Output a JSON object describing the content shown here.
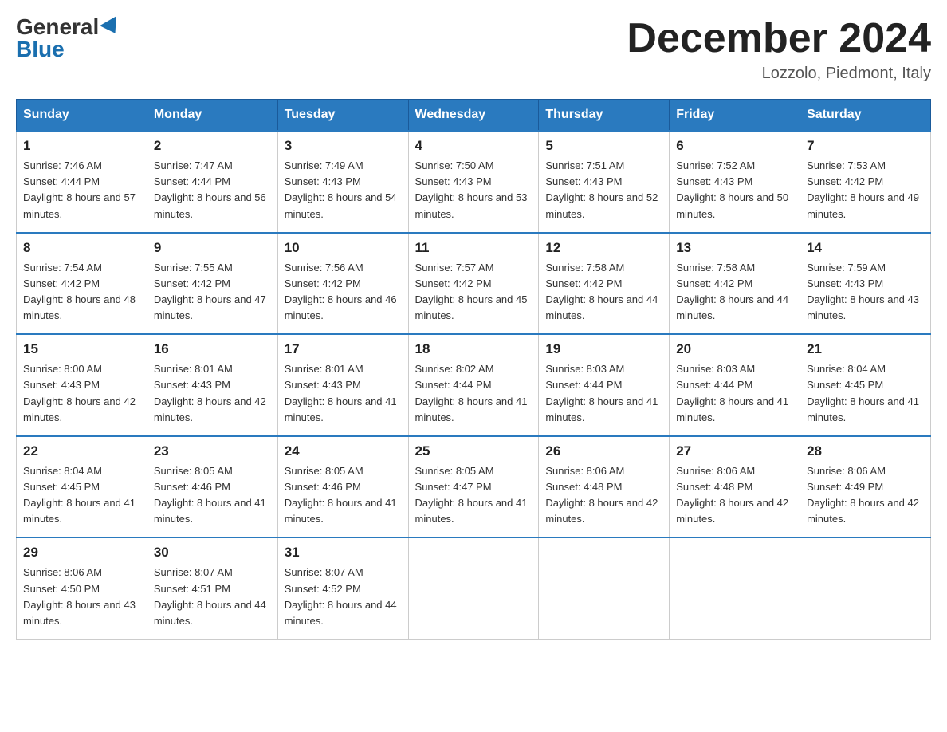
{
  "header": {
    "logo_general": "General",
    "logo_blue": "Blue",
    "month_title": "December 2024",
    "location": "Lozzolo, Piedmont, Italy"
  },
  "days_of_week": [
    "Sunday",
    "Monday",
    "Tuesday",
    "Wednesday",
    "Thursday",
    "Friday",
    "Saturday"
  ],
  "weeks": [
    [
      {
        "day": "1",
        "sunrise": "7:46 AM",
        "sunset": "4:44 PM",
        "daylight": "8 hours and 57 minutes."
      },
      {
        "day": "2",
        "sunrise": "7:47 AM",
        "sunset": "4:44 PM",
        "daylight": "8 hours and 56 minutes."
      },
      {
        "day": "3",
        "sunrise": "7:49 AM",
        "sunset": "4:43 PM",
        "daylight": "8 hours and 54 minutes."
      },
      {
        "day": "4",
        "sunrise": "7:50 AM",
        "sunset": "4:43 PM",
        "daylight": "8 hours and 53 minutes."
      },
      {
        "day": "5",
        "sunrise": "7:51 AM",
        "sunset": "4:43 PM",
        "daylight": "8 hours and 52 minutes."
      },
      {
        "day": "6",
        "sunrise": "7:52 AM",
        "sunset": "4:43 PM",
        "daylight": "8 hours and 50 minutes."
      },
      {
        "day": "7",
        "sunrise": "7:53 AM",
        "sunset": "4:42 PM",
        "daylight": "8 hours and 49 minutes."
      }
    ],
    [
      {
        "day": "8",
        "sunrise": "7:54 AM",
        "sunset": "4:42 PM",
        "daylight": "8 hours and 48 minutes."
      },
      {
        "day": "9",
        "sunrise": "7:55 AM",
        "sunset": "4:42 PM",
        "daylight": "8 hours and 47 minutes."
      },
      {
        "day": "10",
        "sunrise": "7:56 AM",
        "sunset": "4:42 PM",
        "daylight": "8 hours and 46 minutes."
      },
      {
        "day": "11",
        "sunrise": "7:57 AM",
        "sunset": "4:42 PM",
        "daylight": "8 hours and 45 minutes."
      },
      {
        "day": "12",
        "sunrise": "7:58 AM",
        "sunset": "4:42 PM",
        "daylight": "8 hours and 44 minutes."
      },
      {
        "day": "13",
        "sunrise": "7:58 AM",
        "sunset": "4:42 PM",
        "daylight": "8 hours and 44 minutes."
      },
      {
        "day": "14",
        "sunrise": "7:59 AM",
        "sunset": "4:43 PM",
        "daylight": "8 hours and 43 minutes."
      }
    ],
    [
      {
        "day": "15",
        "sunrise": "8:00 AM",
        "sunset": "4:43 PM",
        "daylight": "8 hours and 42 minutes."
      },
      {
        "day": "16",
        "sunrise": "8:01 AM",
        "sunset": "4:43 PM",
        "daylight": "8 hours and 42 minutes."
      },
      {
        "day": "17",
        "sunrise": "8:01 AM",
        "sunset": "4:43 PM",
        "daylight": "8 hours and 41 minutes."
      },
      {
        "day": "18",
        "sunrise": "8:02 AM",
        "sunset": "4:44 PM",
        "daylight": "8 hours and 41 minutes."
      },
      {
        "day": "19",
        "sunrise": "8:03 AM",
        "sunset": "4:44 PM",
        "daylight": "8 hours and 41 minutes."
      },
      {
        "day": "20",
        "sunrise": "8:03 AM",
        "sunset": "4:44 PM",
        "daylight": "8 hours and 41 minutes."
      },
      {
        "day": "21",
        "sunrise": "8:04 AM",
        "sunset": "4:45 PM",
        "daylight": "8 hours and 41 minutes."
      }
    ],
    [
      {
        "day": "22",
        "sunrise": "8:04 AM",
        "sunset": "4:45 PM",
        "daylight": "8 hours and 41 minutes."
      },
      {
        "day": "23",
        "sunrise": "8:05 AM",
        "sunset": "4:46 PM",
        "daylight": "8 hours and 41 minutes."
      },
      {
        "day": "24",
        "sunrise": "8:05 AM",
        "sunset": "4:46 PM",
        "daylight": "8 hours and 41 minutes."
      },
      {
        "day": "25",
        "sunrise": "8:05 AM",
        "sunset": "4:47 PM",
        "daylight": "8 hours and 41 minutes."
      },
      {
        "day": "26",
        "sunrise": "8:06 AM",
        "sunset": "4:48 PM",
        "daylight": "8 hours and 42 minutes."
      },
      {
        "day": "27",
        "sunrise": "8:06 AM",
        "sunset": "4:48 PM",
        "daylight": "8 hours and 42 minutes."
      },
      {
        "day": "28",
        "sunrise": "8:06 AM",
        "sunset": "4:49 PM",
        "daylight": "8 hours and 42 minutes."
      }
    ],
    [
      {
        "day": "29",
        "sunrise": "8:06 AM",
        "sunset": "4:50 PM",
        "daylight": "8 hours and 43 minutes."
      },
      {
        "day": "30",
        "sunrise": "8:07 AM",
        "sunset": "4:51 PM",
        "daylight": "8 hours and 44 minutes."
      },
      {
        "day": "31",
        "sunrise": "8:07 AM",
        "sunset": "4:52 PM",
        "daylight": "8 hours and 44 minutes."
      },
      null,
      null,
      null,
      null
    ]
  ]
}
